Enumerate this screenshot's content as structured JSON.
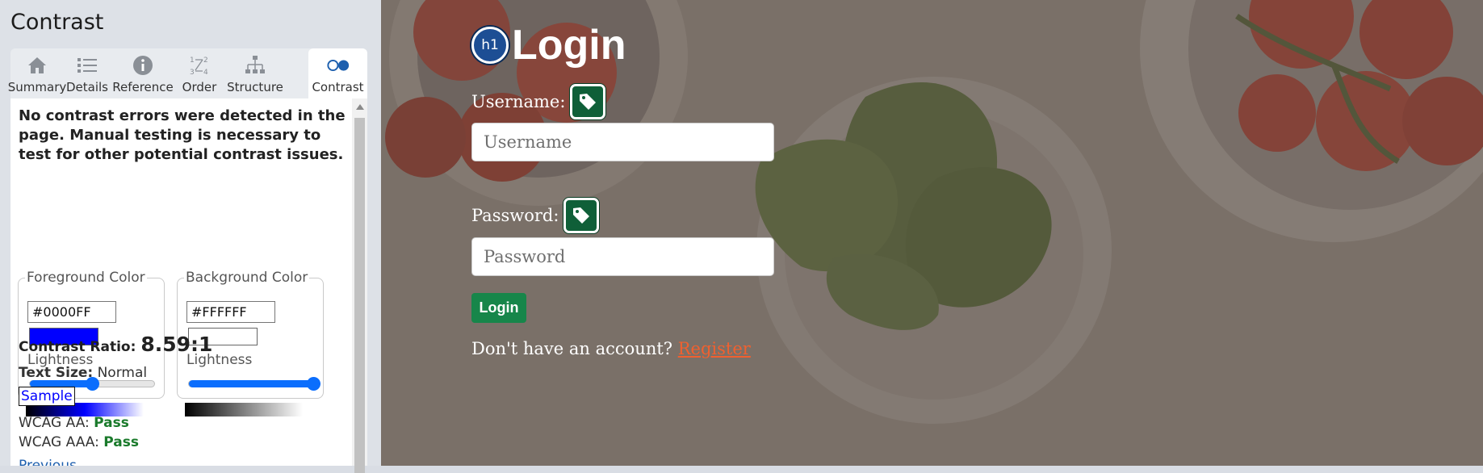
{
  "panel": {
    "title": "Contrast",
    "tabs": [
      {
        "label": "Summary",
        "icon": "home-icon"
      },
      {
        "label": "Details",
        "icon": "list-icon"
      },
      {
        "label": "Reference",
        "icon": "info-icon"
      },
      {
        "label": "Order",
        "icon": "order-icon"
      },
      {
        "label": "Structure",
        "icon": "structure-icon"
      },
      {
        "label": "Contrast",
        "icon": "contrast-icon",
        "active": true
      }
    ],
    "message": "No contrast errors were detected in the page. Manual testing is necessary to test for other potential contrast issues.",
    "foreground": {
      "legend": "Foreground Color",
      "hex": "#0000FF",
      "lightness_label": "Lightness",
      "lightness": 0.5
    },
    "background": {
      "legend": "Background Color",
      "hex": "#FFFFFF",
      "lightness_label": "Lightness",
      "lightness": 1.0
    },
    "ratio_label": "Contrast Ratio:",
    "ratio_value": "8.59:1",
    "text_size_label": "Text Size:",
    "text_size_value": "Normal",
    "sample_text": "Sample",
    "wcag_aa_label": "WCAG AA:",
    "wcag_aa_value": "Pass",
    "wcag_aaa_label": "WCAG AAA:",
    "wcag_aaa_value": "Pass",
    "more_link": "Previous"
  },
  "page": {
    "h1_badge": "h1",
    "title": "Login",
    "username_label": "Username:",
    "username_placeholder": "Username",
    "password_label": "Password:",
    "password_placeholder": "Password",
    "login_button": "Login",
    "account_text": "Don't have an account?",
    "register_link": "Register"
  },
  "colors": {
    "pass": "#1a7a2b",
    "primary": "#0b6efd",
    "login_button": "#17864a",
    "register_link": "#f0602f",
    "tag_badge": "#0f5f38",
    "h1_badge": "#1d4e94"
  }
}
